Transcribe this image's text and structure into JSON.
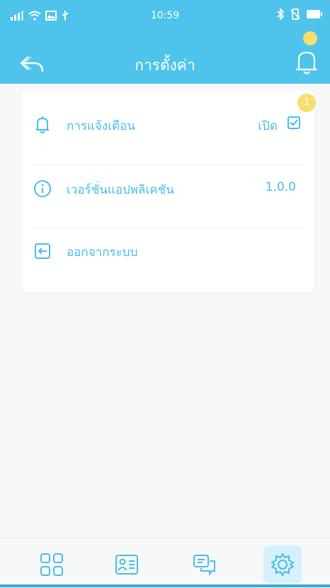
{
  "status_bar": {
    "time": "10:59",
    "signal_icon": "signal-icon",
    "wifi_icon": "wifi-icon",
    "bluetooth_icon": "bluetooth-icon",
    "battery_icon": "battery-icon"
  },
  "header": {
    "title": "การตั้งค่า",
    "back_icon": "back-arrow-icon",
    "bell_icon": "bell-icon"
  },
  "badge": {
    "count": "1"
  },
  "settings": {
    "notification": {
      "label": "การแจ้งเตือน",
      "value": "เปิด",
      "checked": true,
      "icon": "bell-icon"
    },
    "version": {
      "label": "เวอร์ชั่นแอปพลิเคชัน",
      "value": "1.0.0",
      "icon": "info-icon"
    },
    "logout": {
      "label": "ออกจากระบบ",
      "icon": "logout-icon"
    }
  },
  "tab_bar": {
    "tabs": [
      {
        "name": "grid-icon"
      },
      {
        "name": "contact-card-icon"
      },
      {
        "name": "chat-icon"
      },
      {
        "name": "gear-icon",
        "active": true
      }
    ]
  },
  "colors": {
    "header": "#4ec3ec",
    "accent": "#48bde6",
    "badge": "#f6df6e"
  }
}
